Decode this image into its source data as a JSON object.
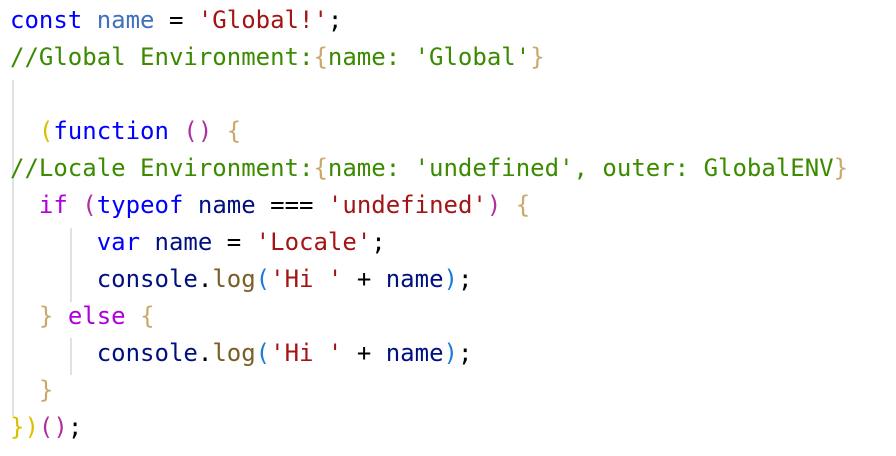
{
  "editor": {
    "colors": {
      "keyword": "#0000ff",
      "control": "#af00db",
      "variable": "#001080",
      "declaration": "#4070c0",
      "string": "#a31515",
      "comment": "#3b8b00",
      "function": "#795e26",
      "bracket_gold": "#d8c000",
      "bracket_purple": "#b02fa0",
      "bracket_blue": "#1a7bd8",
      "bracket_tan": "#c9a96b",
      "punctuation": "#000000",
      "indent_guide": "#e1e1e1"
    },
    "lines": [
      [
        {
          "t": "const",
          "c": "keyword"
        },
        {
          "t": " ",
          "c": "punctuation"
        },
        {
          "t": "name",
          "c": "declaration"
        },
        {
          "t": " = ",
          "c": "punctuation"
        },
        {
          "t": "'Global!'",
          "c": "string"
        },
        {
          "t": ";",
          "c": "punctuation"
        }
      ],
      [
        {
          "t": "//Global Environment:",
          "c": "comment"
        },
        {
          "t": "{",
          "c": "bracket_tan"
        },
        {
          "t": "name: 'Global'",
          "c": "comment"
        },
        {
          "t": "}",
          "c": "bracket_tan"
        }
      ],
      [],
      [
        {
          "t": "  ",
          "c": "punctuation"
        },
        {
          "t": "(",
          "c": "bracket_gold"
        },
        {
          "t": "function",
          "c": "keyword"
        },
        {
          "t": " ",
          "c": "punctuation"
        },
        {
          "t": "()",
          "c": "bracket_purple"
        },
        {
          "t": " ",
          "c": "punctuation"
        },
        {
          "t": "{",
          "c": "bracket_tan"
        }
      ],
      [
        {
          "t": "//Locale Environment:",
          "c": "comment"
        },
        {
          "t": "{",
          "c": "bracket_tan"
        },
        {
          "t": "name: 'undefined', outer: GlobalENV",
          "c": "comment"
        },
        {
          "t": "}",
          "c": "bracket_tan"
        }
      ],
      [
        {
          "t": "  ",
          "c": "punctuation"
        },
        {
          "t": "if",
          "c": "control"
        },
        {
          "t": " ",
          "c": "punctuation"
        },
        {
          "t": "(",
          "c": "bracket_purple"
        },
        {
          "t": "typeof",
          "c": "keyword"
        },
        {
          "t": " ",
          "c": "punctuation"
        },
        {
          "t": "name",
          "c": "variable"
        },
        {
          "t": " === ",
          "c": "punctuation"
        },
        {
          "t": "'undefined'",
          "c": "string"
        },
        {
          "t": ")",
          "c": "bracket_purple"
        },
        {
          "t": " ",
          "c": "punctuation"
        },
        {
          "t": "{",
          "c": "bracket_tan"
        }
      ],
      [
        {
          "t": "      ",
          "c": "punctuation"
        },
        {
          "t": "var",
          "c": "keyword"
        },
        {
          "t": " ",
          "c": "punctuation"
        },
        {
          "t": "name",
          "c": "variable"
        },
        {
          "t": " = ",
          "c": "punctuation"
        },
        {
          "t": "'Locale'",
          "c": "string"
        },
        {
          "t": ";",
          "c": "punctuation"
        }
      ],
      [
        {
          "t": "      ",
          "c": "punctuation"
        },
        {
          "t": "console",
          "c": "variable"
        },
        {
          "t": ".",
          "c": "punctuation"
        },
        {
          "t": "log",
          "c": "function"
        },
        {
          "t": "(",
          "c": "bracket_blue"
        },
        {
          "t": "'Hi '",
          "c": "string"
        },
        {
          "t": " + ",
          "c": "punctuation"
        },
        {
          "t": "name",
          "c": "variable"
        },
        {
          "t": ")",
          "c": "bracket_blue"
        },
        {
          "t": ";",
          "c": "punctuation"
        }
      ],
      [
        {
          "t": "  ",
          "c": "punctuation"
        },
        {
          "t": "}",
          "c": "bracket_tan"
        },
        {
          "t": " ",
          "c": "punctuation"
        },
        {
          "t": "else",
          "c": "control"
        },
        {
          "t": " ",
          "c": "punctuation"
        },
        {
          "t": "{",
          "c": "bracket_tan"
        }
      ],
      [
        {
          "t": "      ",
          "c": "punctuation"
        },
        {
          "t": "console",
          "c": "variable"
        },
        {
          "t": ".",
          "c": "punctuation"
        },
        {
          "t": "log",
          "c": "function"
        },
        {
          "t": "(",
          "c": "bracket_blue"
        },
        {
          "t": "'Hi '",
          "c": "string"
        },
        {
          "t": " + ",
          "c": "punctuation"
        },
        {
          "t": "name",
          "c": "variable"
        },
        {
          "t": ")",
          "c": "bracket_blue"
        },
        {
          "t": ";",
          "c": "punctuation"
        }
      ],
      [
        {
          "t": "  ",
          "c": "punctuation"
        },
        {
          "t": "}",
          "c": "bracket_tan"
        }
      ],
      [
        {
          "t": "}",
          "c": "bracket_gold"
        },
        {
          "t": ")",
          "c": "bracket_gold"
        },
        {
          "t": "()",
          "c": "bracket_purple"
        },
        {
          "t": ";",
          "c": "punctuation"
        }
      ]
    ]
  }
}
